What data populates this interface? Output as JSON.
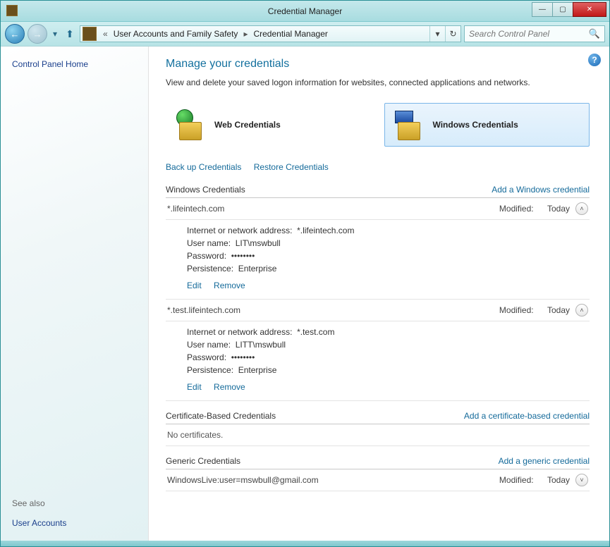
{
  "window": {
    "title": "Credential Manager"
  },
  "breadcrumb": {
    "chevrons": "«",
    "seg1": "User Accounts and Family Safety",
    "arrow": "▸",
    "seg2": "Credential Manager"
  },
  "search": {
    "placeholder": "Search Control Panel"
  },
  "sidebar": {
    "home": "Control Panel Home",
    "see_also": "See also",
    "user_accounts": "User Accounts"
  },
  "main": {
    "heading": "Manage your credentials",
    "subtitle": "View and delete your saved logon information for websites, connected applications and networks.",
    "vault_web": "Web Credentials",
    "vault_win": "Windows Credentials",
    "backup": "Back up Credentials",
    "restore": "Restore Credentials",
    "modified_label": "Modified:",
    "today": "Today",
    "edit": "Edit",
    "remove": "Remove",
    "addr_label": "Internet or network address:",
    "user_label": "User name:",
    "pwd_label": "Password:",
    "pwd_mask": "••••••••",
    "persist_label": "Persistence:",
    "sections": {
      "windows": {
        "title": "Windows Credentials",
        "add": "Add a Windows credential"
      },
      "cert": {
        "title": "Certificate-Based Credentials",
        "add": "Add a certificate-based credential",
        "empty": "No certificates."
      },
      "generic": {
        "title": "Generic Credentials",
        "add": "Add a generic credential"
      }
    },
    "win_creds": [
      {
        "name": "*.lifeintech.com",
        "addr": "*.lifeintech.com",
        "user": "LIT\\mswbull",
        "persist": "Enterprise"
      },
      {
        "name": "*.test.lifeintech.com",
        "addr": "*.test.com",
        "user": "LITT\\mswbull",
        "persist": "Enterprise"
      }
    ],
    "generic_creds": [
      {
        "name": "WindowsLive:user=mswbull@gmail.com"
      }
    ]
  }
}
